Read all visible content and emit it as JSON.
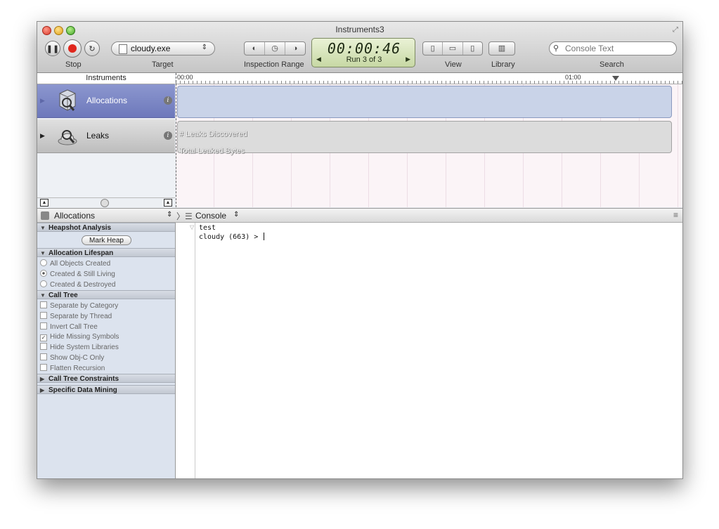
{
  "window": {
    "title": "Instruments3"
  },
  "toolbar": {
    "stop_label": "Stop",
    "target_label": "Target",
    "target_value": "cloudy.exe",
    "inspection_range_label": "Inspection Range",
    "timer": "00:00:46",
    "run_label": "Run 3 of 3",
    "view_label": "View",
    "library_label": "Library",
    "search_label": "Search",
    "search_placeholder": "Console Text"
  },
  "instruments": {
    "header": "Instruments",
    "items": [
      {
        "name": "Allocations",
        "selected": true
      },
      {
        "name": "Leaks",
        "selected": false
      }
    ]
  },
  "timeline": {
    "start": "00:00",
    "mark": "01:00",
    "leaks_tracks": [
      "# Leaks Discovered",
      "Total Leaked Bytes"
    ]
  },
  "detail_bar": {
    "instrument_selector": "Allocations",
    "view_selector": "Console"
  },
  "inspector": {
    "sections": {
      "heapshot": "Heapshot Analysis",
      "lifespan": "Allocation Lifespan",
      "call_tree": "Call Tree",
      "constraints": "Call Tree Constraints",
      "data_mining": "Specific Data Mining"
    },
    "mark_heap": "Mark Heap",
    "lifespan_options": [
      {
        "label": "All Objects Created",
        "selected": false
      },
      {
        "label": "Created & Still Living",
        "selected": true
      },
      {
        "label": "Created & Destroyed",
        "selected": false
      }
    ],
    "call_tree_options": [
      {
        "label": "Separate by Category",
        "checked": false
      },
      {
        "label": "Separate by Thread",
        "checked": false
      },
      {
        "label": "Invert Call Tree",
        "checked": false
      },
      {
        "label": "Hide Missing Symbols",
        "checked": true
      },
      {
        "label": "Hide System Libraries",
        "checked": false
      },
      {
        "label": "Show Obj-C Only",
        "checked": false
      },
      {
        "label": "Flatten Recursion",
        "checked": false
      }
    ]
  },
  "console": {
    "lines": [
      "test",
      "cloudy (663) > "
    ]
  }
}
